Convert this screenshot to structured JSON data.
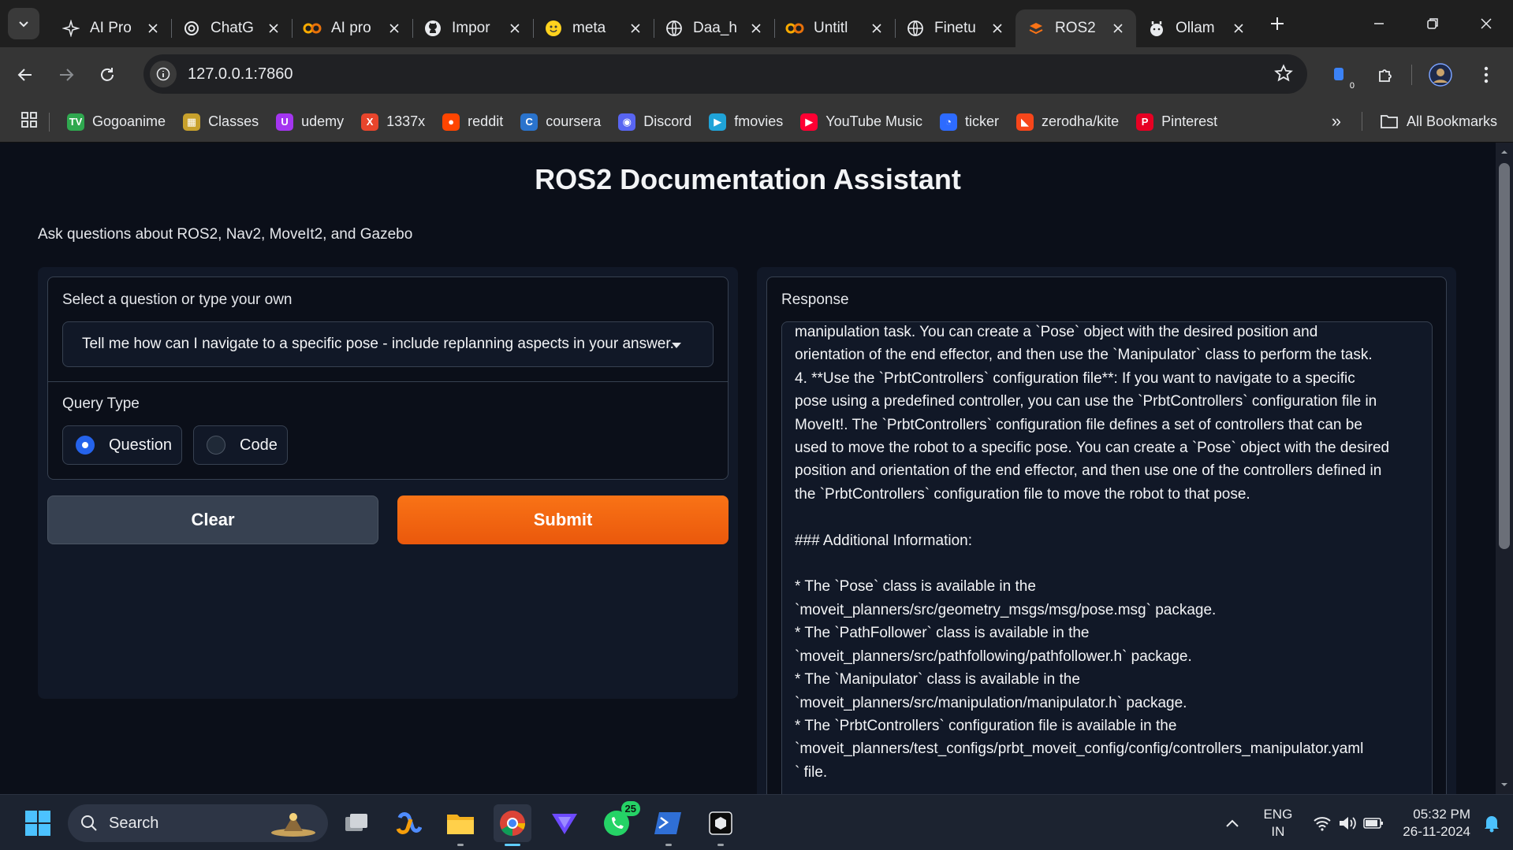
{
  "browser": {
    "tabs": [
      {
        "title": "AI Pro",
        "icon": "ai-pro-favicon"
      },
      {
        "title": "ChatG",
        "icon": "openai-favicon"
      },
      {
        "title": "AI pro",
        "icon": "colab-favicon"
      },
      {
        "title": "Impor",
        "icon": "github-favicon"
      },
      {
        "title": "meta",
        "icon": "huggingface-favicon"
      },
      {
        "title": "Daa_h",
        "icon": "globe-favicon"
      },
      {
        "title": "Untitl",
        "icon": "colab-favicon"
      },
      {
        "title": "Finetu",
        "icon": "globe-favicon"
      },
      {
        "title": "ROS2",
        "icon": "gradio-favicon"
      },
      {
        "title": "Ollam",
        "icon": "ollama-favicon"
      }
    ],
    "url": "127.0.0.1:7860",
    "extension_badge": "0",
    "bookmarks": [
      {
        "label": "Gogoanime",
        "color": "#2fa84f",
        "glyph": "TV"
      },
      {
        "label": "Classes",
        "color": "#c8a12c",
        "glyph": "▦"
      },
      {
        "label": "udemy",
        "color": "#a435f0",
        "glyph": "U"
      },
      {
        "label": "1337x",
        "color": "#e8452c",
        "glyph": "X"
      },
      {
        "label": "reddit",
        "color": "#ff4500",
        "glyph": "●"
      },
      {
        "label": "coursera",
        "color": "#2a73cc",
        "glyph": "C"
      },
      {
        "label": "Discord",
        "color": "#5865f2",
        "glyph": "◉"
      },
      {
        "label": "fmovies",
        "color": "#1fa3d8",
        "glyph": "▶"
      },
      {
        "label": "YouTube Music",
        "color": "#ff0033",
        "glyph": "▶"
      },
      {
        "label": "ticker",
        "color": "#2d6bff",
        "glyph": "◔"
      },
      {
        "label": "zerodha/kite",
        "color": "#f6461a",
        "glyph": "◣"
      },
      {
        "label": "Pinterest",
        "color": "#e60023",
        "glyph": "P"
      }
    ],
    "all_bookmarks_label": "All Bookmarks"
  },
  "app": {
    "title": "ROS2 Documentation Assistant",
    "subtitle": "Ask questions about ROS2, Nav2, MoveIt2, and Gazebo",
    "question_label": "Select a question or type your own",
    "question_value": "Tell me how can I navigate to a specific pose - include replanning aspects in your answer.",
    "query_type_label": "Query Type",
    "query_options": [
      "Question",
      "Code"
    ],
    "query_selected": "Question",
    "clear_label": "Clear",
    "submit_label": "Submit",
    "response_label": "Response",
    "response_text": "manipulation task. You can create a `Pose` object with the desired position and\norientation of the end effector, and then use the `Manipulator` class to perform the task.\n4. **Use the `PrbtControllers` configuration file**: If you want to navigate to a specific\npose using a predefined controller, you can use the `PrbtControllers` configuration file in\nMoveIt!. The `PrbtControllers` configuration file defines a set of controllers that can be\nused to move the robot to a specific pose. You can create a `Pose` object with the desired\nposition and orientation of the end effector, and then use one of the controllers defined in\nthe `PrbtControllers` configuration file to move the robot to that pose.\n\n### Additional Information:\n\n* The `Pose` class is available in the\n`moveit_planners/src/geometry_msgs/msg/pose.msg` package.\n* The `PathFollower` class is available in the\n`moveit_planners/src/pathfollowing/pathfollower.h` package.\n* The `Manipulator` class is available in the\n`moveit_planners/src/manipulation/manipulator.h` package.\n* The `PrbtControllers` configuration file is available in the\n`moveit_planners/test_configs/prbt_moveit_config/config/controllers_manipulator.yaml\n` file."
  },
  "taskbar": {
    "search_placeholder": "Search",
    "whatsapp_badge": "25",
    "lang_line1": "ENG",
    "lang_line2": "IN",
    "time": "05:32 PM",
    "date": "26-11-2024"
  },
  "colors": {
    "accent_orange": "#f97316",
    "radio_blue": "#2563eb",
    "page_bg": "#0b0f19"
  }
}
